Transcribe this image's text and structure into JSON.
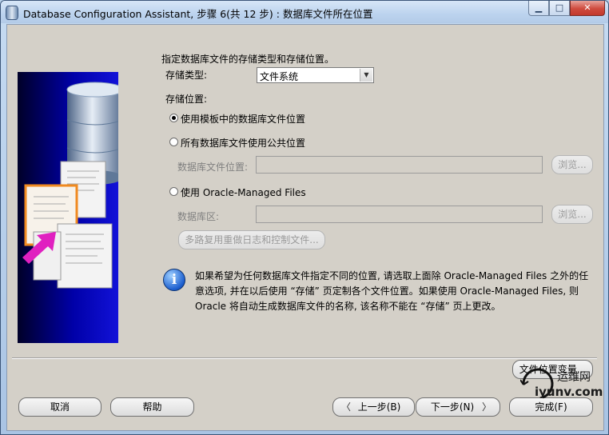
{
  "window": {
    "title": "Database Configuration Assistant, 步骤 6(共 12 步) : 数据库文件所在位置",
    "minimize_glyph": "▁",
    "maximize_glyph": "□",
    "close_glyph": "✕"
  },
  "illustration": {
    "doc_lines": [
      "Xxxxxxxxxxxxxxx",
      "Xxxxxxxxxxxxxx",
      "Xxxxxxxxxxxxxxx",
      "Xxxxxxxxxxxxx"
    ]
  },
  "main": {
    "intro": "指定数据库文件的存储类型和存储位置。",
    "storage_type_label": "存储类型:",
    "storage_type_value": "文件系统",
    "storage_location_label": "存储位置:",
    "options": [
      {
        "label": "使用模板中的数据库文件位置",
        "selected": true
      },
      {
        "label": "所有数据库文件使用公共位置",
        "selected": false
      },
      {
        "label": "使用 Oracle-Managed Files",
        "selected": false
      }
    ],
    "db_file_location_label": "数据库文件位置:",
    "db_area_label": "数据库区:",
    "browse_label": "浏览...",
    "multiplex_button": "多路复用重做日志和控制文件...",
    "info_text": "如果希望为任何数据库文件指定不同的位置, 请选取上面除 Oracle-Managed Files 之外的任意选项, 并在以后使用 “存储” 页定制各个文件位置。如果使用 Oracle-Managed Files, 则 Oracle 将自动生成数据库文件的名称, 该名称不能在 “存储” 页上更改。",
    "file_location_variables_button": "文件位置变量..."
  },
  "footer": {
    "cancel": "取消",
    "help": "帮助",
    "back": "上一步(B)",
    "next": "下一步(N)",
    "finish": "完成(F)"
  },
  "watermark": {
    "line1": "运维网",
    "line2": "iyunv.com"
  },
  "colors": {
    "dialog_bg": "#d4d0c8",
    "illustration_blue": "#0000a8",
    "arrow_magenta": "#e020c0",
    "disabled_text": "#808080"
  }
}
